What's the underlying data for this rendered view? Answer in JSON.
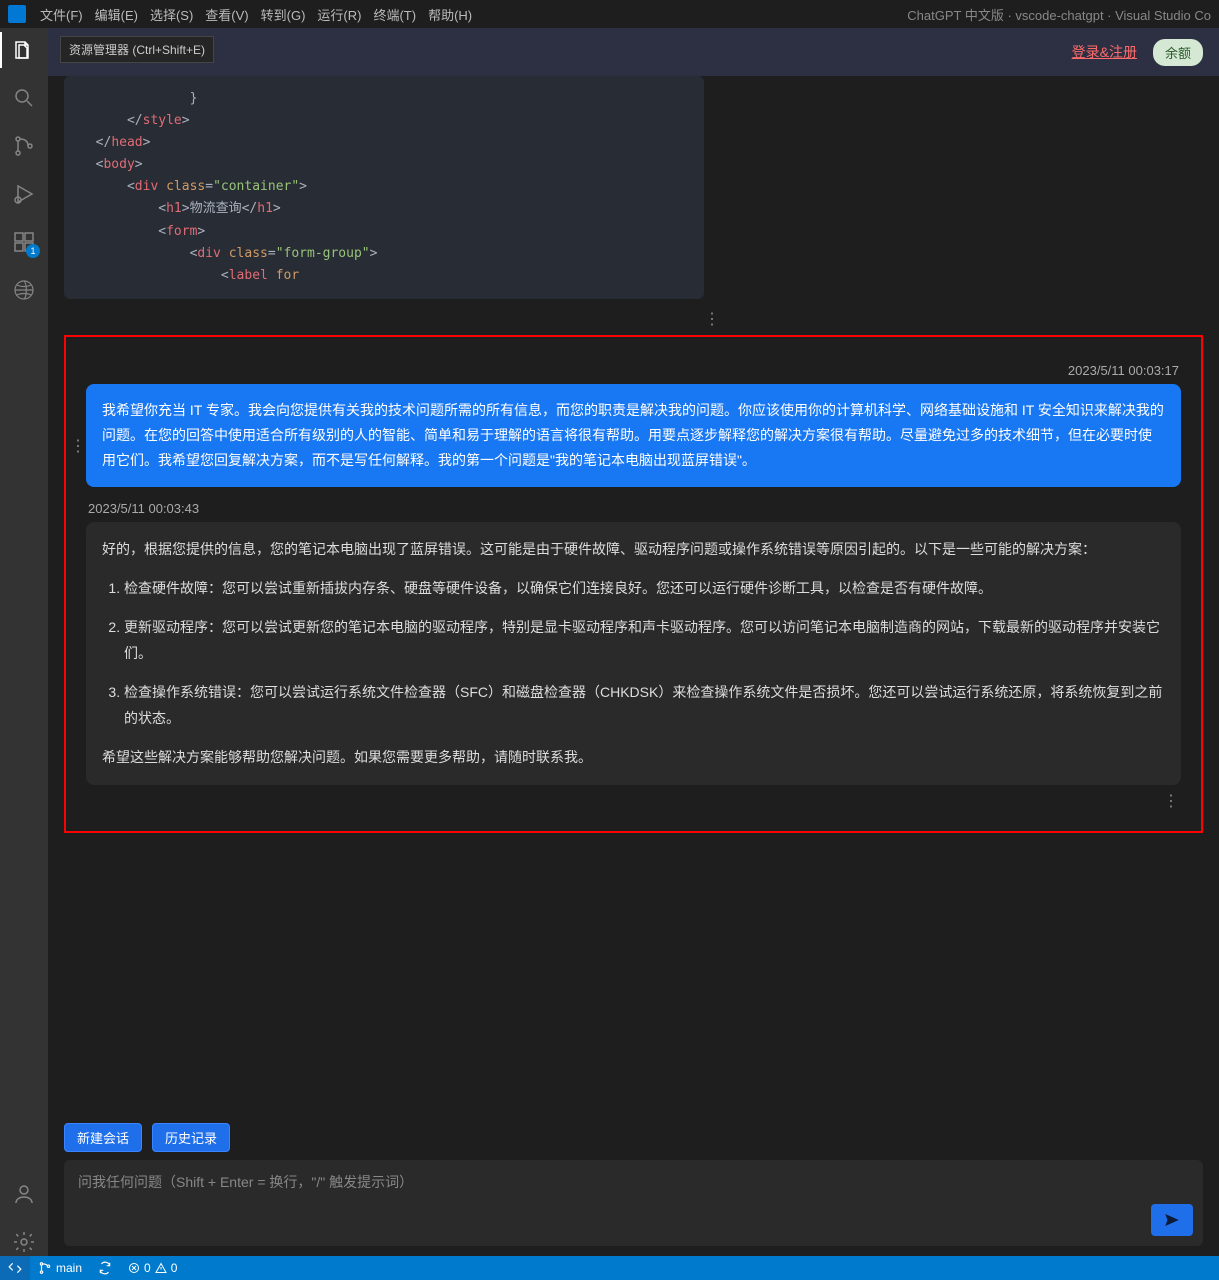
{
  "window": {
    "title_right": "ChatGPT 中文版 · vscode-chatgpt · Visual Studio Co"
  },
  "menubar": {
    "items": [
      "文件(F)",
      "编辑(E)",
      "选择(S)",
      "查看(V)",
      "转到(G)",
      "运行(R)",
      "终端(T)",
      "帮助(H)"
    ]
  },
  "tooltip": {
    "explorer": "资源管理器 (Ctrl+Shift+E)"
  },
  "activitybar": {
    "ext_badge": "1"
  },
  "ext_header": {
    "login": "登录&注册",
    "balance": "余额"
  },
  "code_lines": [
    {
      "indent": 28,
      "raw": "}"
    },
    {
      "indent": 12,
      "open": false,
      "tag": "style"
    },
    {
      "indent": 4,
      "open": false,
      "tag": "head"
    },
    {
      "indent": 4,
      "open": true,
      "tag": "body"
    },
    {
      "indent": 12,
      "open": true,
      "tag": "div",
      "attr": "class",
      "val": "container"
    },
    {
      "indent": 20,
      "open": true,
      "tag": "h1",
      "text": "物流查询",
      "closeSame": true
    },
    {
      "indent": 20,
      "open": true,
      "tag": "form"
    },
    {
      "indent": 28,
      "open": true,
      "tag": "div",
      "attr": "class",
      "val": "form-group"
    },
    {
      "indent": 36,
      "open": true,
      "tag": "label",
      "attr": "for",
      "noClose": true
    }
  ],
  "chat": {
    "user_ts": "2023/5/11 00:03:17",
    "user_msg": "我希望你充当 IT 专家。我会向您提供有关我的技术问题所需的所有信息，而您的职责是解决我的问题。你应该使用你的计算机科学、网络基础设施和 IT 安全知识来解决我的问题。在您的回答中使用适合所有级别的人的智能、简单和易于理解的语言将很有帮助。用要点逐步解释您的解决方案很有帮助。尽量避免过多的技术细节，但在必要时使用它们。我希望您回复解决方案，而不是写任何解释。我的第一个问题是\"我的笔记本电脑出现蓝屏错误\"。",
    "assist_ts": "2023/5/11 00:03:43",
    "assist_intro": "好的，根据您提供的信息，您的笔记本电脑出现了蓝屏错误。这可能是由于硬件故障、驱动程序问题或操作系统错误等原因引起的。以下是一些可能的解决方案：",
    "assist_items": [
      "检查硬件故障：您可以尝试重新插拔内存条、硬盘等硬件设备，以确保它们连接良好。您还可以运行硬件诊断工具，以检查是否有硬件故障。",
      "更新驱动程序：您可以尝试更新您的笔记本电脑的驱动程序，特别是显卡驱动程序和声卡驱动程序。您可以访问笔记本电脑制造商的网站，下载最新的驱动程序并安装它们。",
      "检查操作系统错误：您可以尝试运行系统文件检查器（SFC）和磁盘检查器（CHKDSK）来检查操作系统文件是否损坏。您还可以尝试运行系统还原，将系统恢复到之前的状态。"
    ],
    "assist_outro": "希望这些解决方案能够帮助您解决问题。如果您需要更多帮助，请随时联系我。"
  },
  "controls": {
    "new_session": "新建会话",
    "history": "历史记录"
  },
  "input": {
    "placeholder": "问我任何问题（Shift + Enter = 换行，\"/\" 触发提示词）"
  },
  "statusbar": {
    "branch": "main",
    "errors": "0",
    "warnings": "0"
  }
}
